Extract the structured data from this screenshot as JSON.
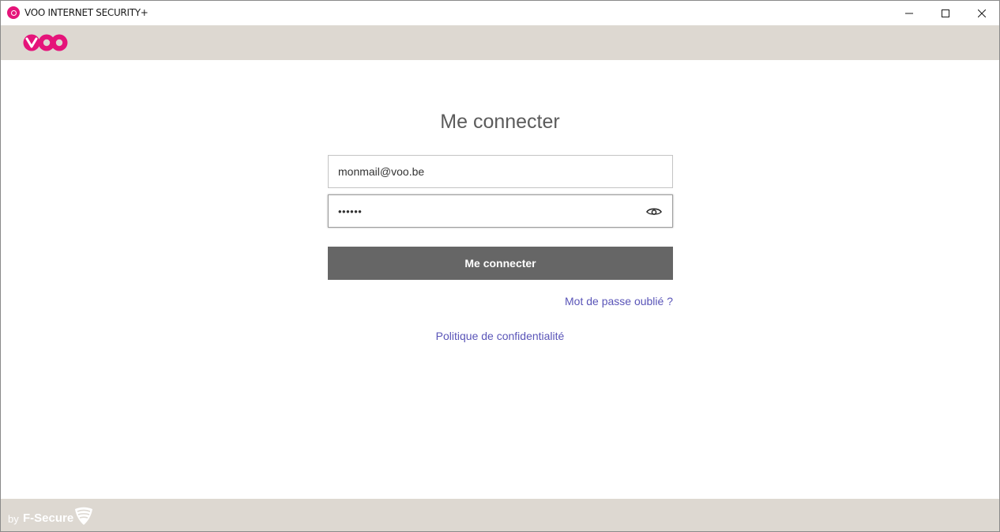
{
  "window": {
    "title": "VOO INTERNET SECURITY+",
    "controls": [
      "minimize",
      "maximize",
      "close"
    ]
  },
  "header": {
    "logo": "voo-logo",
    "brand_color": "#e5147a"
  },
  "login": {
    "title": "Me connecter",
    "email_value": "monmail@voo.be",
    "password_value": "••••••",
    "submit_label": "Me connecter",
    "forgot_password_label": "Mot de passe oublié ?",
    "privacy_label": "Politique de confidentialité"
  },
  "footer": {
    "by_label": "by",
    "brand_label": "F-Secure"
  },
  "colors": {
    "accent": "#e5147a",
    "header_bg": "#ddd8d1",
    "button_bg": "#666666",
    "link": "#5a55b8"
  },
  "icons": {
    "window_min": "minimize-icon",
    "window_max": "maximize-icon",
    "window_close": "close-icon",
    "password_toggle": "eye-icon",
    "footer_logo": "f-secure-logo"
  }
}
